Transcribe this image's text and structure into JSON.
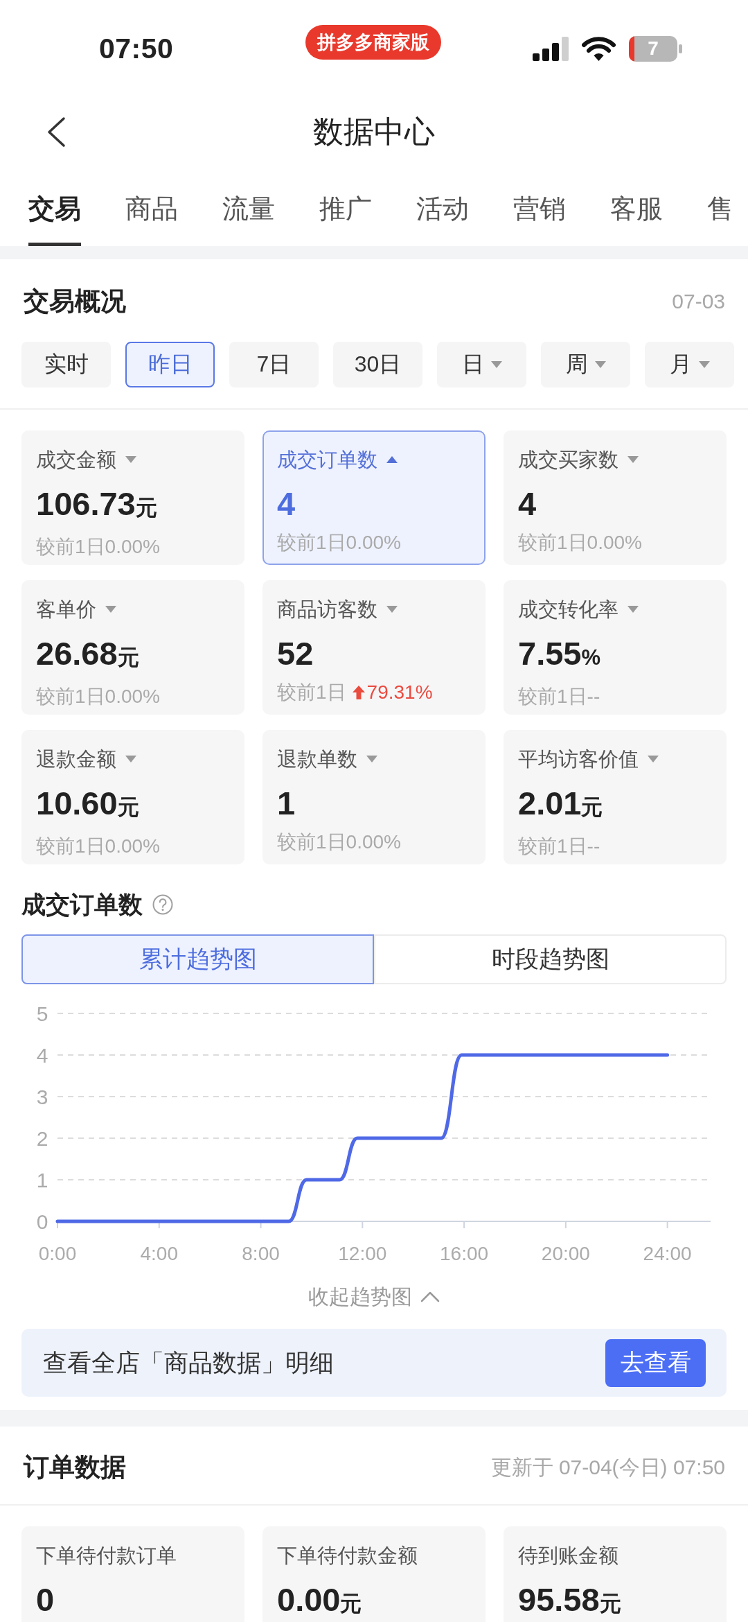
{
  "status_bar": {
    "time": "07:50",
    "app_badge": "拼多多商家版",
    "battery": "7"
  },
  "header": {
    "title": "数据中心"
  },
  "tabs": [
    {
      "label": "交易",
      "selected": true
    },
    {
      "label": "商品",
      "selected": false
    },
    {
      "label": "流量",
      "selected": false
    },
    {
      "label": "推广",
      "selected": false
    },
    {
      "label": "活动",
      "selected": false
    },
    {
      "label": "营销",
      "selected": false
    },
    {
      "label": "客服",
      "selected": false
    },
    {
      "label": "售",
      "selected": false
    }
  ],
  "overview": {
    "title": "交易概况",
    "date": "07-03",
    "periods": [
      {
        "label": "实时",
        "kind": "preset",
        "selected": false
      },
      {
        "label": "昨日",
        "kind": "preset",
        "selected": true
      },
      {
        "label": "7日",
        "kind": "preset",
        "selected": false
      },
      {
        "label": "30日",
        "kind": "preset",
        "selected": false
      },
      {
        "label": "日",
        "kind": "dropdown",
        "selected": false
      },
      {
        "label": "周",
        "kind": "dropdown",
        "selected": false
      },
      {
        "label": "月",
        "kind": "dropdown",
        "selected": false
      }
    ],
    "metrics": [
      {
        "label": "成交金额",
        "value": "106.73",
        "unit": "元",
        "compare_label": "较前1日",
        "change": "0.00%",
        "rising": false,
        "selected": false
      },
      {
        "label": "成交订单数",
        "value": "4",
        "compare_label": "较前1日",
        "change": "0.00%",
        "rising": false,
        "selected": true
      },
      {
        "label": "成交买家数",
        "value": "4",
        "compare_label": "较前1日",
        "change": "0.00%",
        "rising": false,
        "selected": false
      },
      {
        "label": "客单价",
        "value": "26.68",
        "unit": "元",
        "compare_label": "较前1日",
        "change": "0.00%",
        "rising": false,
        "selected": false
      },
      {
        "label": "商品访客数",
        "value": "52",
        "compare_label": "较前1日",
        "change": "79.31%",
        "rising": true,
        "selected": false
      },
      {
        "label": "成交转化率",
        "value": "7.55",
        "unit": "%",
        "compare_label": "较前1日",
        "change": "--",
        "rising": false,
        "selected": false
      },
      {
        "label": "退款金额",
        "value": "10.60",
        "unit": "元",
        "compare_label": "较前1日",
        "change": "0.00%",
        "rising": false,
        "selected": false
      },
      {
        "label": "退款单数",
        "value": "1",
        "compare_label": "较前1日",
        "change": "0.00%",
        "rising": false,
        "selected": false
      },
      {
        "label": "平均访客价值",
        "value": "2.01",
        "unit": "元",
        "compare_label": "较前1日",
        "change": "--",
        "rising": false,
        "selected": false
      }
    ]
  },
  "trend": {
    "title": "成交订单数",
    "views": [
      {
        "label": "累计趋势图",
        "selected": true
      },
      {
        "label": "时段趋势图",
        "selected": false
      }
    ],
    "chart_data": {
      "type": "line",
      "x": [
        0,
        9.1,
        9.8,
        11.1,
        11.8,
        15.1,
        15.9,
        24
      ],
      "values": [
        0,
        0,
        1,
        1,
        2,
        2,
        4,
        4
      ],
      "xlim": [
        0,
        25.7
      ],
      "ylim": [
        0,
        5
      ],
      "grid": true,
      "xticks": [
        {
          "value": 0,
          "label": "0:00"
        },
        {
          "value": 4,
          "label": "4:00"
        },
        {
          "value": 8,
          "label": "8:00"
        },
        {
          "value": 12,
          "label": "12:00"
        },
        {
          "value": 16,
          "label": "16:00"
        },
        {
          "value": 20,
          "label": "20:00"
        },
        {
          "value": 24,
          "label": "24:00"
        }
      ],
      "yticks": [
        0,
        1,
        2,
        3,
        4,
        5
      ]
    },
    "collapse_label": "收起趋势图"
  },
  "promo": {
    "text": "查看全店「商品数据」明细",
    "button": "去查看"
  },
  "orders": {
    "title": "订单数据",
    "updated": "更新于 07-04(今日) 07:50",
    "metrics": [
      {
        "label": "下单待付款订单",
        "value": "0"
      },
      {
        "label": "下单待付款金额",
        "value": "0.00",
        "unit": "元"
      },
      {
        "label": "待到账金额",
        "value": "95.58",
        "unit": "元"
      }
    ]
  }
}
